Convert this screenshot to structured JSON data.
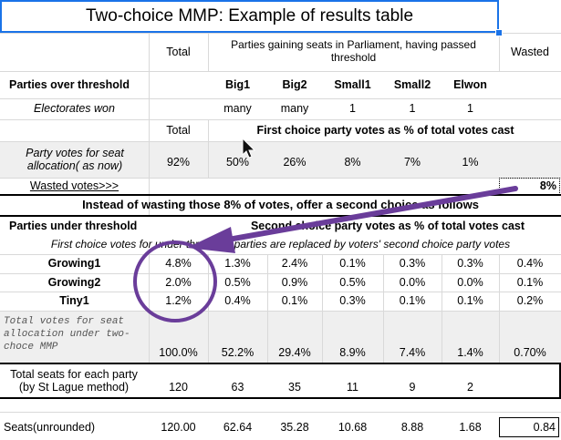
{
  "title": "Two-choice MMP:  Example of results table",
  "header": {
    "total": "Total",
    "parties_gaining": "Parties gaining seats in Parliament, having passed threshold",
    "wasted": "Wasted"
  },
  "parties_over_label": "Parties over threshold",
  "parties": [
    "Big1",
    "Big2",
    "Small1",
    "Small2",
    "Elwon"
  ],
  "electorates": {
    "label": "Electorates won",
    "values": [
      "many",
      "many",
      "1",
      "1",
      "1"
    ]
  },
  "first_choice": {
    "total": "Total",
    "title": "First choice party votes as % of total votes cast"
  },
  "party_votes": {
    "label": "Party votes for seat allocation( as now)",
    "total": "92%",
    "values": [
      "50%",
      "26%",
      "8%",
      "7%",
      "1%"
    ]
  },
  "wasted_votes": {
    "label": "Wasted votes>>>",
    "value": "8%"
  },
  "banner": "Instead of wasting those 8% of votes, offer a second choice as follows",
  "under": {
    "label": "Parties under threshold",
    "title": "Second choice party votes as % of total votes cast"
  },
  "note": "First choice votes for under threshold parties are replaced by voters' second choice party votes",
  "under_rows": [
    {
      "name": "Growing1",
      "total": "4.8%",
      "values": [
        "1.3%",
        "2.4%",
        "0.1%",
        "0.3%",
        "0.3%"
      ],
      "wasted": "0.4%"
    },
    {
      "name": "Growing2",
      "total": "2.0%",
      "values": [
        "0.5%",
        "0.9%",
        "0.5%",
        "0.0%",
        "0.0%"
      ],
      "wasted": "0.1%"
    },
    {
      "name": "Tiny1",
      "total": "1.2%",
      "values": [
        "0.4%",
        "0.1%",
        "0.3%",
        "0.1%",
        "0.1%"
      ],
      "wasted": "0.2%"
    }
  ],
  "total_votes": {
    "label": "Total votes for seat allocation under two-choce MMP",
    "total": "100.0%",
    "values": [
      "52.2%",
      "29.4%",
      "8.9%",
      "7.4%",
      "1.4%"
    ],
    "wasted": "0.70%"
  },
  "total_seats": {
    "label": "Total seats for each party (by St Lague method)",
    "total": "120",
    "values": [
      "63",
      "35",
      "11",
      "9",
      "2"
    ]
  },
  "unrounded": {
    "label": "Seats(unrounded)",
    "total": "120.00",
    "values": [
      "62.64",
      "35.28",
      "10.68",
      "8.88",
      "1.68"
    ],
    "wasted": "0.84"
  },
  "colors": {
    "arrow": "#6a3d9a",
    "circle": "#6a3d9a",
    "grey_fill": "#efefef",
    "selection": "#1a73e8"
  },
  "icons": [
    "mouse-cursor-icon",
    "annotation-arrow-icon",
    "highlight-circle-icon"
  ]
}
